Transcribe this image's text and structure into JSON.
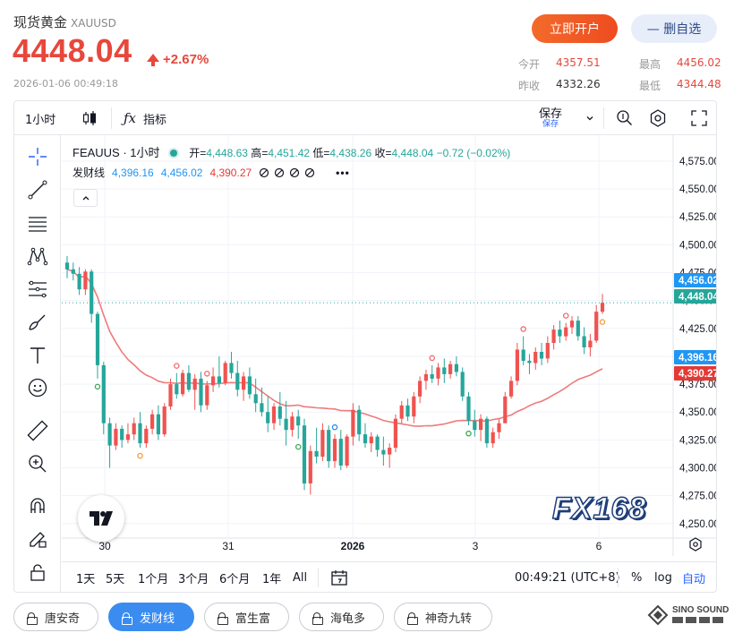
{
  "header": {
    "name": "现货黄金",
    "code": "XAUUSD",
    "price": "4448.04",
    "change_pct": "+2.67%",
    "timestamp": "2026-01-06 00:49:18",
    "open_account_label": "立即开户",
    "unfavorite_label": "— 删自选",
    "stats": [
      {
        "label": "今开",
        "value": "4357.51"
      },
      {
        "label": "最高",
        "value": "4456.02"
      },
      {
        "label": "昨收",
        "value": "4332.26"
      },
      {
        "label": "最低",
        "value": "4344.48"
      }
    ],
    "accent_color": "#e8473b"
  },
  "toolbar": {
    "interval": "1小时",
    "indicators_label": "指标",
    "save_label": "保存",
    "save_sub": "保存"
  },
  "legend": {
    "symbol": "FEAUUS · 1小时",
    "open_label": "开",
    "open": "4,448.63",
    "high_label": "高",
    "high": "4,451.42",
    "low_label": "低",
    "low": "4,438.26",
    "close_label": "收",
    "close": "4,448.04",
    "change": "−0.72 (−0.02%)",
    "indicator_name": "发财线",
    "ind_v1": "4,396.16",
    "ind_v2": "4,456.02",
    "ind_v3": "4,390.27"
  },
  "bottom_bar": {
    "ranges": [
      "1天",
      "5天",
      "1个月",
      "3个月",
      "6个月",
      "1年",
      "All"
    ],
    "clock": "00:49:21 (UTC+8)",
    "pct": "%",
    "log": "log",
    "auto": "自动"
  },
  "strategies": [
    "唐安奇",
    "发财线",
    "富生富",
    "海龟多",
    "神奇九转"
  ],
  "active_strategy": "发财线",
  "watermark": "FX168",
  "brand_name": "SINO SOUND",
  "chart_data": {
    "type": "candlestick",
    "x_labels": [
      "30",
      "31",
      "2026",
      "3",
      "6"
    ],
    "y_ticks": [
      4575,
      4550,
      4525,
      4500,
      4475,
      4450,
      4425,
      4400,
      4375,
      4350,
      4325,
      4300,
      4275,
      4250
    ],
    "ylim": [
      4237,
      4587
    ],
    "price_tags": [
      {
        "value": 4456.02,
        "label": "4,456.02",
        "color": "#2196f3"
      },
      {
        "value": 4448.04,
        "label": "4,448.04",
        "color": "#26a69a"
      },
      {
        "value": 4396.16,
        "label": "4,396.16",
        "color": "#2196f3"
      },
      {
        "value": 4390.27,
        "label": "4,390.27",
        "color": "#e53935"
      }
    ],
    "colors": {
      "up": "#ef5350",
      "down": "#26a69a",
      "ma": "#ef7b7b"
    },
    "candles": [
      [
        4484,
        4490,
        4470,
        4478
      ],
      [
        4478,
        4484,
        4468,
        4474
      ],
      [
        4474,
        4480,
        4455,
        4460
      ],
      [
        4460,
        4478,
        4455,
        4476
      ],
      [
        4476,
        4478,
        4430,
        4438
      ],
      [
        4438,
        4440,
        4380,
        4392
      ],
      [
        4392,
        4395,
        4330,
        4340
      ],
      [
        4340,
        4345,
        4300,
        4320
      ],
      [
        4320,
        4340,
        4316,
        4335
      ],
      [
        4335,
        4338,
        4318,
        4325
      ],
      [
        4325,
        4340,
        4322,
        4330
      ],
      [
        4330,
        4345,
        4325,
        4340
      ],
      [
        4340,
        4350,
        4318,
        4322
      ],
      [
        4322,
        4338,
        4318,
        4335
      ],
      [
        4335,
        4352,
        4330,
        4348
      ],
      [
        4348,
        4356,
        4325,
        4330
      ],
      [
        4330,
        4358,
        4328,
        4355
      ],
      [
        4355,
        4380,
        4352,
        4375
      ],
      [
        4375,
        4385,
        4362,
        4366
      ],
      [
        4366,
        4388,
        4364,
        4385
      ],
      [
        4385,
        4392,
        4368,
        4370
      ],
      [
        4370,
        4384,
        4352,
        4380
      ],
      [
        4380,
        4386,
        4350,
        4356
      ],
      [
        4356,
        4378,
        4352,
        4374
      ],
      [
        4374,
        4390,
        4368,
        4382
      ],
      [
        4382,
        4400,
        4372,
        4376
      ],
      [
        4376,
        4396,
        4374,
        4394
      ],
      [
        4394,
        4404,
        4380,
        4385
      ],
      [
        4385,
        4396,
        4364,
        4370
      ],
      [
        4370,
        4386,
        4360,
        4382
      ],
      [
        4382,
        4390,
        4362,
        4366
      ],
      [
        4366,
        4380,
        4350,
        4358
      ],
      [
        4358,
        4372,
        4346,
        4350
      ],
      [
        4350,
        4364,
        4332,
        4340
      ],
      [
        4340,
        4358,
        4334,
        4355
      ],
      [
        4355,
        4368,
        4338,
        4344
      ],
      [
        4344,
        4360,
        4320,
        4334
      ],
      [
        4334,
        4350,
        4328,
        4346
      ],
      [
        4346,
        4352,
        4326,
        4338
      ],
      [
        4338,
        4344,
        4280,
        4286
      ],
      [
        4286,
        4320,
        4276,
        4315
      ],
      [
        4315,
        4336,
        4304,
        4310
      ],
      [
        4310,
        4340,
        4306,
        4334
      ],
      [
        4334,
        4338,
        4300,
        4306
      ],
      [
        4306,
        4330,
        4300,
        4326
      ],
      [
        4326,
        4334,
        4298,
        4302
      ],
      [
        4302,
        4330,
        4300,
        4328
      ],
      [
        4328,
        4358,
        4320,
        4352
      ],
      [
        4352,
        4356,
        4324,
        4330
      ],
      [
        4330,
        4340,
        4318,
        4322
      ],
      [
        4322,
        4332,
        4314,
        4328
      ],
      [
        4328,
        4330,
        4310,
        4316
      ],
      [
        4316,
        4328,
        4302,
        4312
      ],
      [
        4312,
        4322,
        4300,
        4318
      ],
      [
        4318,
        4348,
        4314,
        4344
      ],
      [
        4344,
        4360,
        4340,
        4356
      ],
      [
        4356,
        4362,
        4342,
        4346
      ],
      [
        4346,
        4368,
        4340,
        4364
      ],
      [
        4364,
        4382,
        4358,
        4378
      ],
      [
        4378,
        4388,
        4370,
        4384
      ],
      [
        4384,
        4392,
        4376,
        4380
      ],
      [
        4380,
        4394,
        4374,
        4390
      ],
      [
        4390,
        4398,
        4376,
        4384
      ],
      [
        4384,
        4396,
        4380,
        4393
      ],
      [
        4393,
        4400,
        4382,
        4386
      ],
      [
        4386,
        4390,
        4360,
        4364
      ],
      [
        4364,
        4368,
        4338,
        4342
      ],
      [
        4342,
        4352,
        4328,
        4334
      ],
      [
        4334,
        4348,
        4324,
        4344
      ],
      [
        4344,
        4346,
        4318,
        4322
      ],
      [
        4322,
        4336,
        4318,
        4332
      ],
      [
        4332,
        4344,
        4326,
        4340
      ],
      [
        4340,
        4368,
        4340,
        4364
      ],
      [
        4364,
        4382,
        4362,
        4378
      ],
      [
        4378,
        4412,
        4374,
        4406
      ],
      [
        4406,
        4418,
        4392,
        4396
      ],
      [
        4396,
        4402,
        4384,
        4394
      ],
      [
        4394,
        4408,
        4388,
        4404
      ],
      [
        4404,
        4412,
        4392,
        4398
      ],
      [
        4398,
        4418,
        4394,
        4412
      ],
      [
        4412,
        4428,
        4406,
        4424
      ],
      [
        4424,
        4432,
        4412,
        4418
      ],
      [
        4418,
        4430,
        4414,
        4426
      ],
      [
        4426,
        4436,
        4420,
        4432
      ],
      [
        4432,
        4436,
        4414,
        4418
      ],
      [
        4418,
        4426,
        4402,
        4408
      ],
      [
        4408,
        4420,
        4400,
        4414
      ],
      [
        4414,
        4446,
        4412,
        4440
      ],
      [
        4440,
        4456,
        4438,
        4448
      ]
    ]
  }
}
